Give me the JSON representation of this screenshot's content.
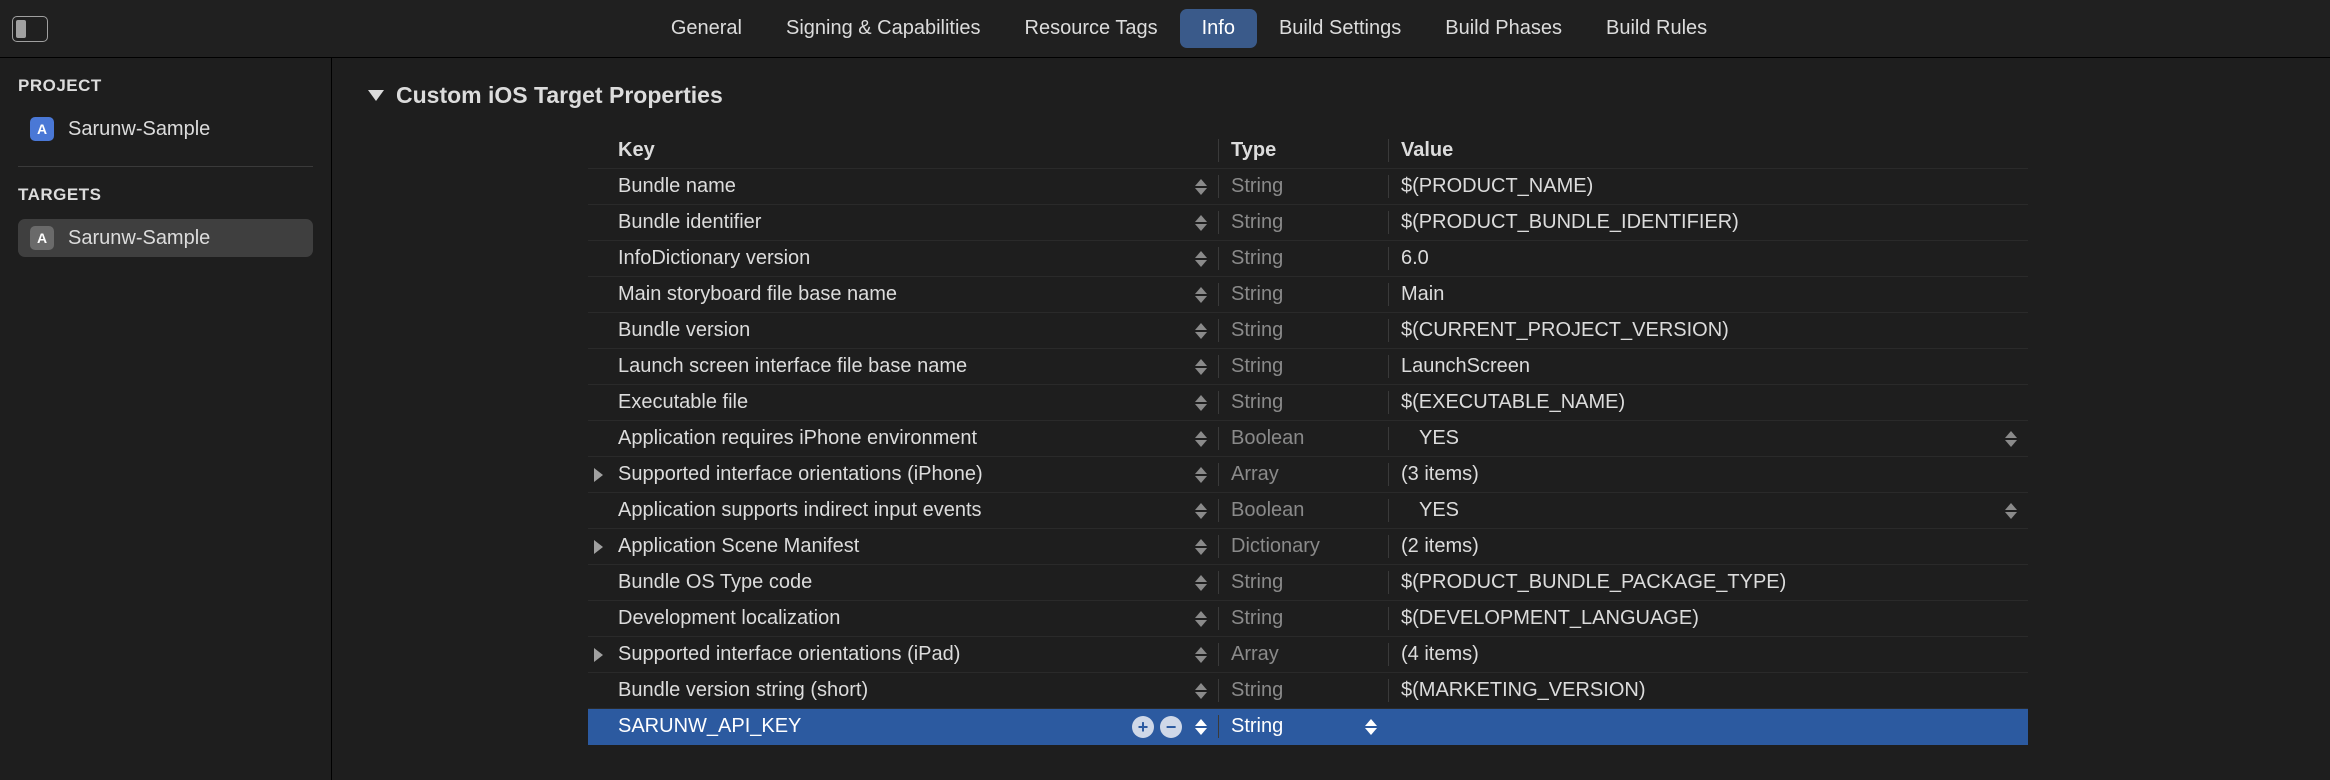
{
  "tabs": [
    "General",
    "Signing & Capabilities",
    "Resource Tags",
    "Info",
    "Build Settings",
    "Build Phases",
    "Build Rules"
  ],
  "activeTab": "Info",
  "sidebar": {
    "projectLabel": "PROJECT",
    "projectName": "Sarunw-Sample",
    "targetsLabel": "TARGETS",
    "targetName": "Sarunw-Sample"
  },
  "section": {
    "title": "Custom iOS Target Properties"
  },
  "columns": {
    "key": "Key",
    "type": "Type",
    "value": "Value"
  },
  "rows": [
    {
      "key": "Bundle name",
      "type": "String",
      "value": "$(PRODUCT_NAME)",
      "hasDisclosure": false,
      "stepperValue": false,
      "selected": false
    },
    {
      "key": "Bundle identifier",
      "type": "String",
      "value": "$(PRODUCT_BUNDLE_IDENTIFIER)",
      "hasDisclosure": false,
      "stepperValue": false,
      "selected": false
    },
    {
      "key": "InfoDictionary version",
      "type": "String",
      "value": "6.0",
      "hasDisclosure": false,
      "stepperValue": false,
      "selected": false
    },
    {
      "key": "Main storyboard file base name",
      "type": "String",
      "value": "Main",
      "hasDisclosure": false,
      "stepperValue": false,
      "selected": false
    },
    {
      "key": "Bundle version",
      "type": "String",
      "value": "$(CURRENT_PROJECT_VERSION)",
      "hasDisclosure": false,
      "stepperValue": false,
      "selected": false
    },
    {
      "key": "Launch screen interface file base name",
      "type": "String",
      "value": "LaunchScreen",
      "hasDisclosure": false,
      "stepperValue": false,
      "selected": false
    },
    {
      "key": "Executable file",
      "type": "String",
      "value": "$(EXECUTABLE_NAME)",
      "hasDisclosure": false,
      "stepperValue": false,
      "selected": false
    },
    {
      "key": "Application requires iPhone environment",
      "type": "Boolean",
      "value": "YES",
      "hasDisclosure": false,
      "stepperValue": true,
      "valueIndent": true,
      "selected": false
    },
    {
      "key": "Supported interface orientations (iPhone)",
      "type": "Array",
      "value": "(3 items)",
      "hasDisclosure": true,
      "stepperValue": false,
      "selected": false
    },
    {
      "key": "Application supports indirect input events",
      "type": "Boolean",
      "value": "YES",
      "hasDisclosure": false,
      "stepperValue": true,
      "valueIndent": true,
      "selected": false
    },
    {
      "key": "Application Scene Manifest",
      "type": "Dictionary",
      "value": "(2 items)",
      "hasDisclosure": true,
      "stepperValue": false,
      "selected": false
    },
    {
      "key": "Bundle OS Type code",
      "type": "String",
      "value": "$(PRODUCT_BUNDLE_PACKAGE_TYPE)",
      "hasDisclosure": false,
      "stepperValue": false,
      "selected": false
    },
    {
      "key": "Development localization",
      "type": "String",
      "value": "$(DEVELOPMENT_LANGUAGE)",
      "hasDisclosure": false,
      "stepperValue": false,
      "selected": false
    },
    {
      "key": "Supported interface orientations (iPad)",
      "type": "Array",
      "value": "(4 items)",
      "hasDisclosure": true,
      "stepperValue": false,
      "selected": false
    },
    {
      "key": "Bundle version string (short)",
      "type": "String",
      "value": "$(MARKETING_VERSION)",
      "hasDisclosure": false,
      "stepperValue": false,
      "selected": false
    },
    {
      "key": "SARUNW_API_KEY",
      "type": "String",
      "value": "",
      "hasDisclosure": false,
      "stepperValue": false,
      "selected": true,
      "showActions": true,
      "typeStepper": true
    }
  ]
}
